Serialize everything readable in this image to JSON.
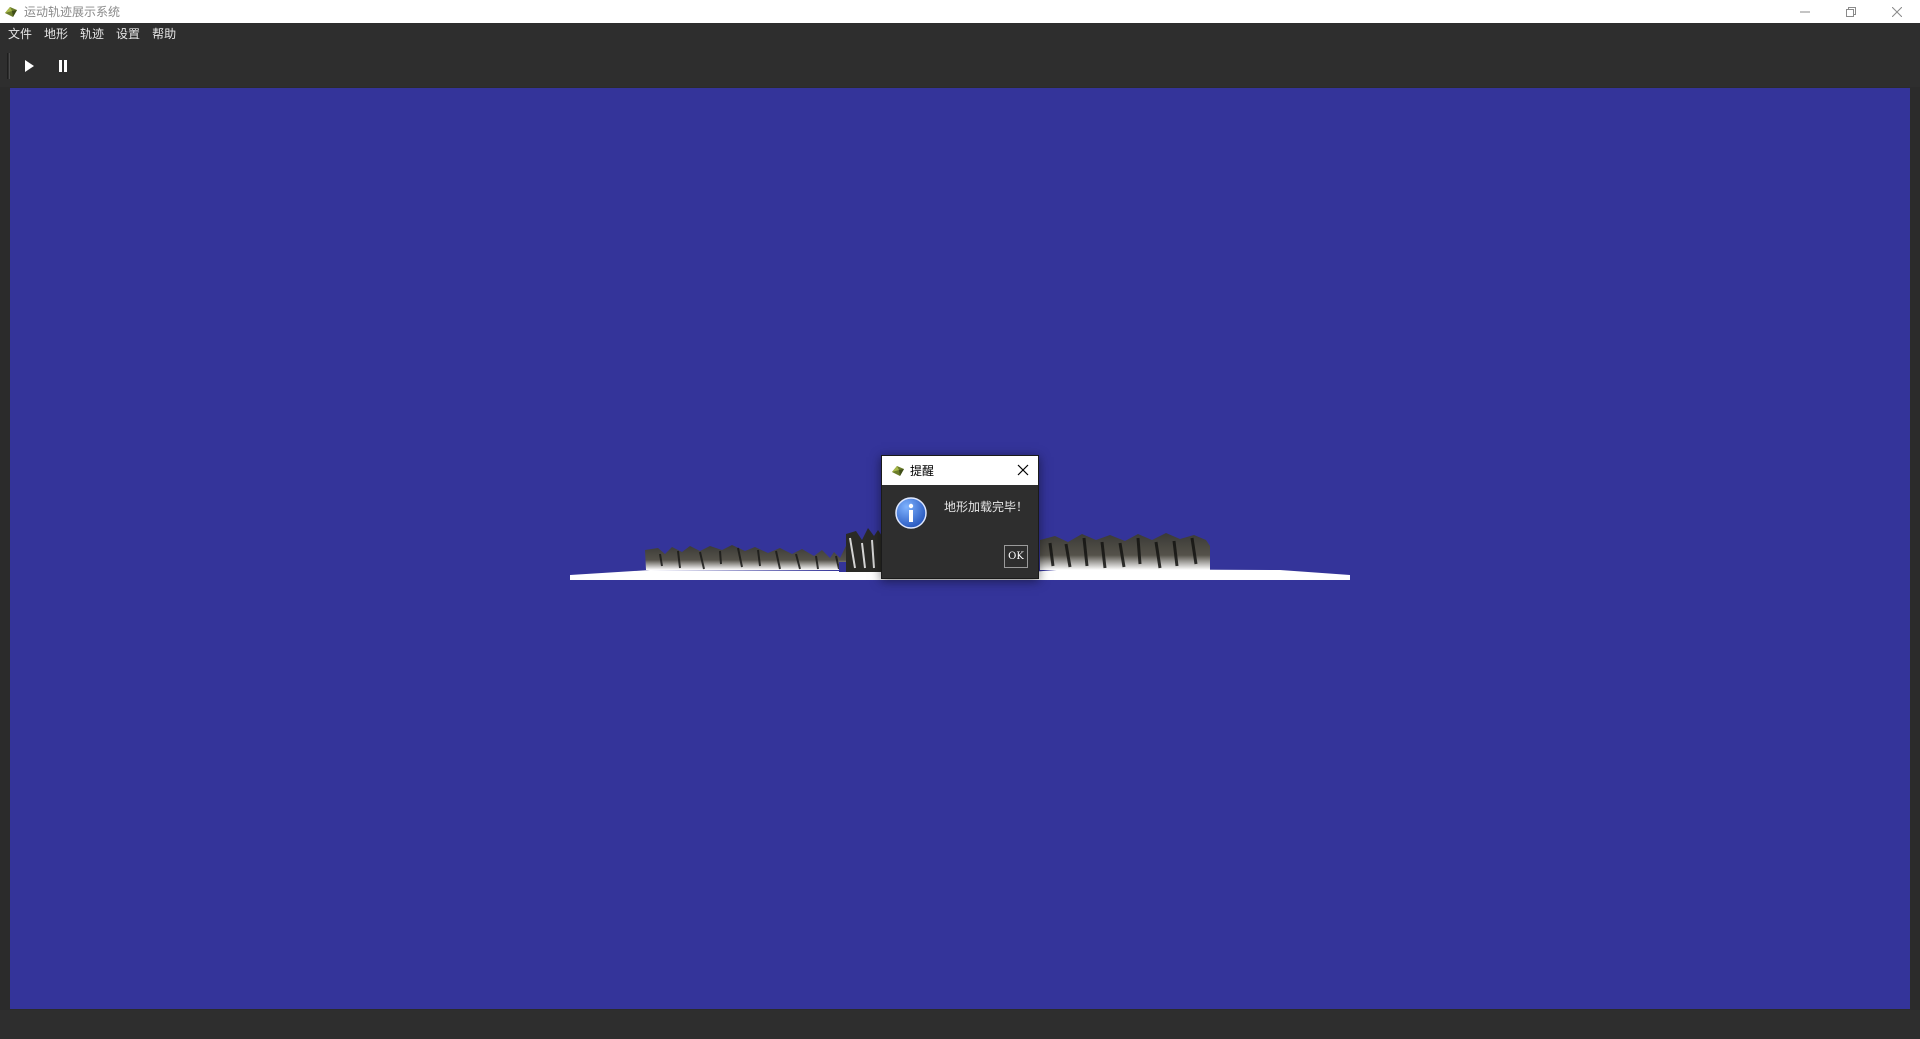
{
  "window": {
    "title": "运动轨迹展示系统",
    "minimize_icon": "minimize-icon",
    "restore_icon": "restore-icon",
    "close_icon": "close-icon"
  },
  "menu": {
    "items": [
      {
        "label": "文件"
      },
      {
        "label": "地形"
      },
      {
        "label": "轨迹"
      },
      {
        "label": "设置"
      },
      {
        "label": "帮助"
      }
    ]
  },
  "toolbar": {
    "play_icon": "play-icon",
    "pause_icon": "pause-icon"
  },
  "viewport": {
    "background_color": "#34349a"
  },
  "dialog": {
    "title": "提醒",
    "message": "地形加载完毕！",
    "ok_label": "OK",
    "icon": "info-icon"
  }
}
